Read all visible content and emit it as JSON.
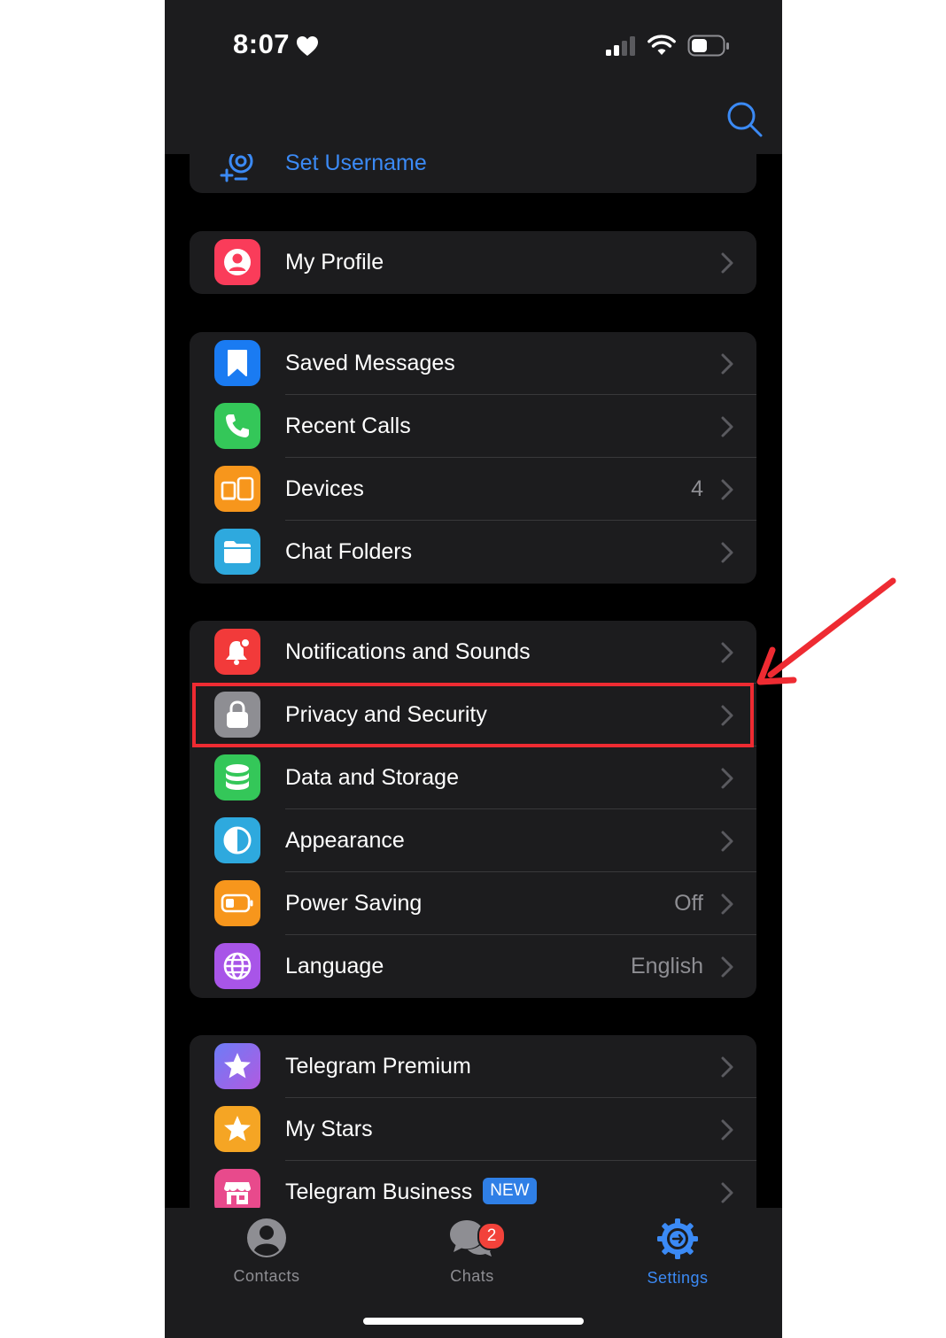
{
  "status_bar": {
    "time": "8:07",
    "icons": [
      "heart-icon",
      "cellular-signal-icon",
      "wifi-icon",
      "battery-icon"
    ]
  },
  "header": {
    "search_icon": "search-icon"
  },
  "username_row": {
    "label": "Set Username",
    "icon": "at-sign-icon"
  },
  "profile_section": {
    "items": [
      {
        "label": "My Profile",
        "icon": "person-icon",
        "color": "#fa3c5a"
      }
    ]
  },
  "section_main": {
    "items": [
      {
        "label": "Saved Messages",
        "icon": "bookmark-icon",
        "color": "#1a7bf2"
      },
      {
        "label": "Recent Calls",
        "icon": "phone-icon",
        "color": "#34c759"
      },
      {
        "label": "Devices",
        "value": "4",
        "icon": "devices-icon",
        "color": "#f7961c"
      },
      {
        "label": "Chat Folders",
        "icon": "folder-icon",
        "color": "#2ea9de"
      }
    ]
  },
  "section_settings": {
    "items": [
      {
        "label": "Notifications and Sounds",
        "icon": "bell-icon",
        "color": "#f23a3a"
      },
      {
        "label": "Privacy and Security",
        "icon": "lock-icon",
        "color": "#8e8e93"
      },
      {
        "label": "Data and Storage",
        "icon": "database-icon",
        "color": "#34c759"
      },
      {
        "label": "Appearance",
        "icon": "half-circle-icon",
        "color": "#2ea9de"
      },
      {
        "label": "Power Saving",
        "value": "Off",
        "icon": "battery-saver-icon",
        "color": "#f7961c"
      },
      {
        "label": "Language",
        "value": "English",
        "icon": "globe-icon",
        "color": "#a855e8"
      }
    ]
  },
  "section_premium": {
    "items": [
      {
        "label": "Telegram Premium",
        "icon": "premium-star-icon",
        "color": "#8a5cf6"
      },
      {
        "label": "My Stars",
        "icon": "star-icon",
        "color": "#f5a524"
      },
      {
        "label": "Telegram Business",
        "badge": "NEW",
        "icon": "store-icon",
        "color": "#e84a8c"
      }
    ]
  },
  "tab_bar": {
    "tabs": [
      {
        "label": "Contacts",
        "icon": "contacts-icon",
        "active": false
      },
      {
        "label": "Chats",
        "icon": "chats-icon",
        "badge": "2",
        "active": false
      },
      {
        "label": "Settings",
        "icon": "settings-icon",
        "active": true
      }
    ]
  },
  "colors": {
    "accent": "#3b8af5",
    "background": "#000000",
    "cell": "#1c1c1e",
    "annotation": "#ee2b32"
  }
}
